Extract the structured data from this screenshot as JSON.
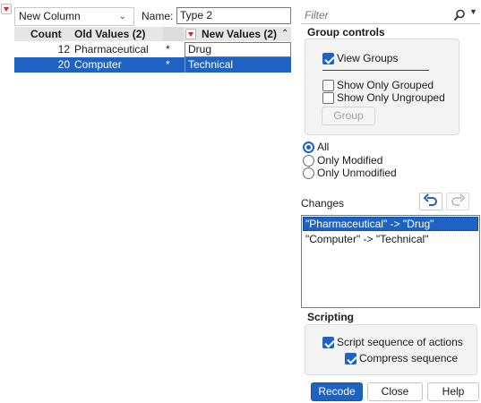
{
  "top": {
    "column_mode": "New Column",
    "name_label": "Name:",
    "name_value": "Type 2"
  },
  "table": {
    "headers": {
      "count": "Count",
      "old": "Old Values (2)",
      "new": "New Values (2)"
    },
    "rows": [
      {
        "count": "12",
        "old": "Pharmaceutical",
        "star": "*",
        "new": "Drug"
      },
      {
        "count": "20",
        "old": "Computer",
        "star": "*",
        "new": "Technical"
      }
    ]
  },
  "filter": {
    "placeholder": "Filter"
  },
  "group_controls": {
    "title": "Group controls",
    "view_groups": "View Groups",
    "show_only_grouped": "Show Only Grouped",
    "show_only_ungrouped": "Show Only Ungrouped",
    "group_button": "Group"
  },
  "view": {
    "all": "All",
    "only_modified": "Only Modified",
    "only_unmodified": "Only Unmodified"
  },
  "changes": {
    "title": "Changes",
    "items": [
      "\"Pharmaceutical\" -> \"Drug\"",
      "\"Computer\" -> \"Technical\""
    ]
  },
  "scripting": {
    "title": "Scripting",
    "script_sequence": "Script sequence of actions",
    "compress_sequence": "Compress sequence"
  },
  "buttons": {
    "recode": "Recode",
    "close": "Close",
    "help": "Help"
  },
  "colors": {
    "accent": "#1e63c4",
    "red_triangle": "#d32626"
  }
}
